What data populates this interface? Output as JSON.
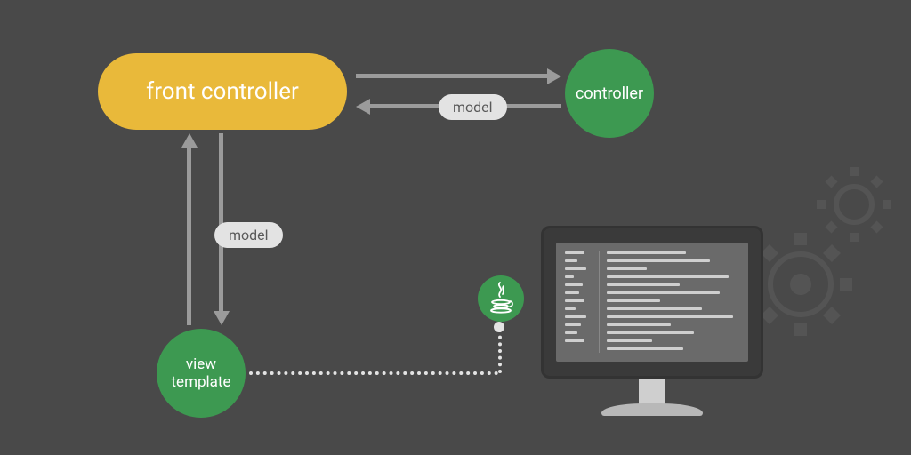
{
  "nodes": {
    "front_controller": "front controller",
    "controller": "controller",
    "view_template": "view\ntemplate"
  },
  "edges": {
    "fc_to_controller_label": "model",
    "fc_to_view_label": "model"
  },
  "colors": {
    "bg": "#494949",
    "yellow": "#e9b93a",
    "green": "#3d9951",
    "arrow": "#9b9b9b",
    "pill_bg": "#e3e3e3",
    "dotted": "#e3e3e3"
  },
  "icons": {
    "java": "java-icon",
    "gears": "gears-icon",
    "monitor": "monitor-icon"
  }
}
